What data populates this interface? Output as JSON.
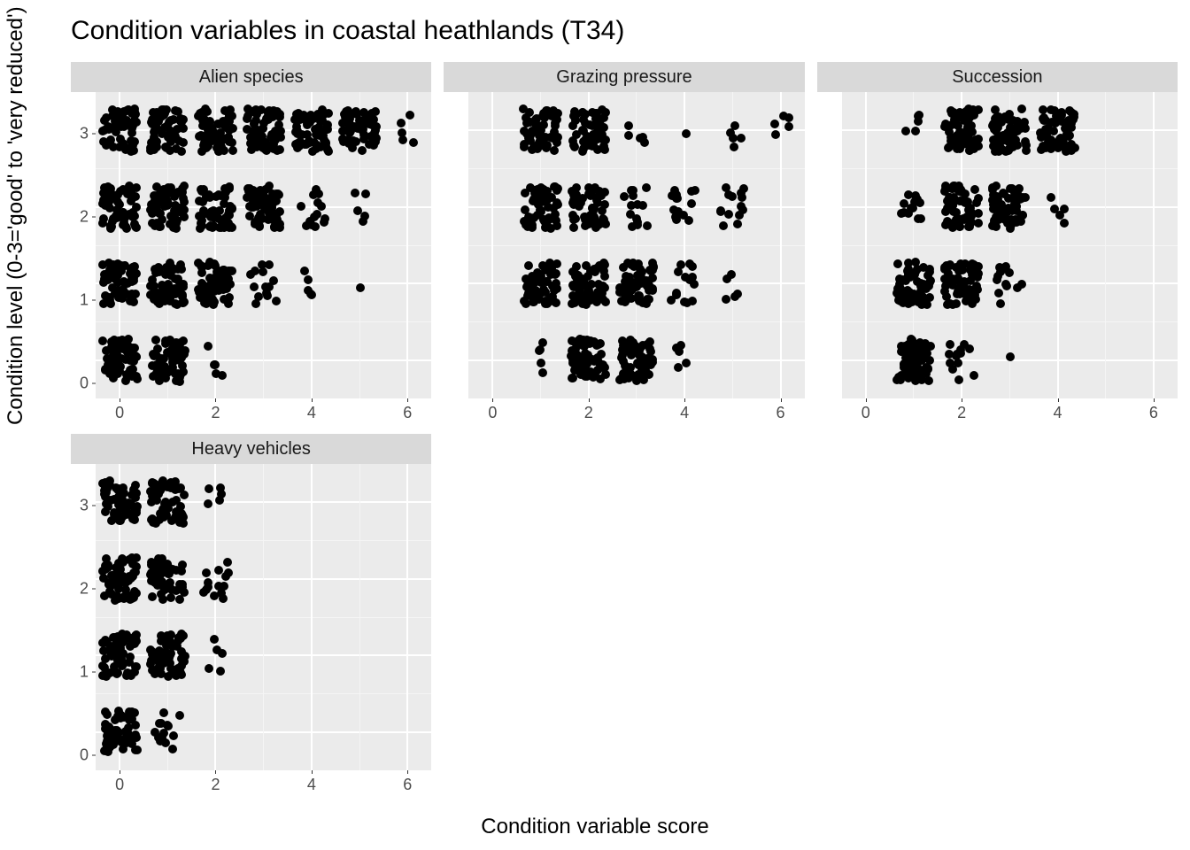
{
  "title": "Condition variables in coastal heathlands (T34)",
  "ylabel": "Condition level (0-3='good' to 'very reduced')",
  "xlabel": "Condition variable score",
  "chart_data": {
    "type": "scatter",
    "xlabel": "Condition variable score",
    "ylabel": "Condition level (0-3='good' to 'very reduced')",
    "title": "Condition variables in coastal heathlands (T34)",
    "xlim": [
      -0.5,
      6.5
    ],
    "ylim": [
      -0.5,
      3.5
    ],
    "xticks": [
      0,
      2,
      4,
      6
    ],
    "yticks": [
      0,
      1,
      2,
      3
    ],
    "panels": [
      {
        "name": "Alien species",
        "cells": [
          {
            "x": 0,
            "y": 0,
            "density": "heavy"
          },
          {
            "x": 1,
            "y": 0,
            "density": "heavy"
          },
          {
            "x": 2,
            "y": 0,
            "density": "few"
          },
          {
            "x": 0,
            "y": 1,
            "density": "heavy"
          },
          {
            "x": 1,
            "y": 1,
            "density": "heavy"
          },
          {
            "x": 2,
            "y": 1,
            "density": "heavy"
          },
          {
            "x": 3,
            "y": 1,
            "density": "scatter"
          },
          {
            "x": 4,
            "y": 1,
            "density": "few"
          },
          {
            "x": 5,
            "y": 1,
            "density": "one"
          },
          {
            "x": 0,
            "y": 2,
            "density": "heavy"
          },
          {
            "x": 1,
            "y": 2,
            "density": "heavy"
          },
          {
            "x": 2,
            "y": 2,
            "density": "heavy"
          },
          {
            "x": 3,
            "y": 2,
            "density": "heavy"
          },
          {
            "x": 4,
            "y": 2,
            "density": "scatter"
          },
          {
            "x": 5,
            "y": 2,
            "density": "few"
          },
          {
            "x": 0,
            "y": 3,
            "density": "heavy"
          },
          {
            "x": 1,
            "y": 3,
            "density": "heavy"
          },
          {
            "x": 2,
            "y": 3,
            "density": "heavy"
          },
          {
            "x": 3,
            "y": 3,
            "density": "heavy"
          },
          {
            "x": 4,
            "y": 3,
            "density": "heavy"
          },
          {
            "x": 5,
            "y": 3,
            "density": "heavy"
          },
          {
            "x": 6,
            "y": 3,
            "density": "few"
          }
        ]
      },
      {
        "name": "Grazing pressure",
        "cells": [
          {
            "x": 1,
            "y": 0,
            "density": "few"
          },
          {
            "x": 2,
            "y": 0,
            "density": "heavy"
          },
          {
            "x": 3,
            "y": 0,
            "density": "heavy"
          },
          {
            "x": 4,
            "y": 0,
            "density": "few"
          },
          {
            "x": 1,
            "y": 1,
            "density": "heavy"
          },
          {
            "x": 2,
            "y": 1,
            "density": "heavy"
          },
          {
            "x": 3,
            "y": 1,
            "density": "heavy"
          },
          {
            "x": 4,
            "y": 1,
            "density": "scatter"
          },
          {
            "x": 5,
            "y": 1,
            "density": "few"
          },
          {
            "x": 1,
            "y": 2,
            "density": "heavy"
          },
          {
            "x": 2,
            "y": 2,
            "density": "heavy"
          },
          {
            "x": 3,
            "y": 2,
            "density": "scatter"
          },
          {
            "x": 4,
            "y": 2,
            "density": "scatter"
          },
          {
            "x": 5,
            "y": 2,
            "density": "scatter"
          },
          {
            "x": 1,
            "y": 3,
            "density": "heavy"
          },
          {
            "x": 2,
            "y": 3,
            "density": "heavy"
          },
          {
            "x": 3,
            "y": 3,
            "density": "few"
          },
          {
            "x": 4,
            "y": 3,
            "density": "one"
          },
          {
            "x": 5,
            "y": 3,
            "density": "few"
          },
          {
            "x": 6,
            "y": 3,
            "density": "few"
          }
        ]
      },
      {
        "name": "Succession",
        "cells": [
          {
            "x": 1,
            "y": 0,
            "density": "heavy"
          },
          {
            "x": 2,
            "y": 0,
            "density": "scatter"
          },
          {
            "x": 3,
            "y": 0,
            "density": "one"
          },
          {
            "x": 1,
            "y": 1,
            "density": "heavy"
          },
          {
            "x": 2,
            "y": 1,
            "density": "heavy"
          },
          {
            "x": 3,
            "y": 1,
            "density": "scatter"
          },
          {
            "x": 1,
            "y": 2,
            "density": "scatter"
          },
          {
            "x": 2,
            "y": 2,
            "density": "heavy"
          },
          {
            "x": 3,
            "y": 2,
            "density": "heavy"
          },
          {
            "x": 4,
            "y": 2,
            "density": "few"
          },
          {
            "x": 1,
            "y": 3,
            "density": "few"
          },
          {
            "x": 2,
            "y": 3,
            "density": "heavy"
          },
          {
            "x": 3,
            "y": 3,
            "density": "heavy"
          },
          {
            "x": 4,
            "y": 3,
            "density": "heavy"
          }
        ]
      },
      {
        "name": "Heavy vehicles",
        "cells": [
          {
            "x": 0,
            "y": 0,
            "density": "heavy"
          },
          {
            "x": 1,
            "y": 0,
            "density": "scatter"
          },
          {
            "x": 0,
            "y": 1,
            "density": "heavy"
          },
          {
            "x": 1,
            "y": 1,
            "density": "heavy"
          },
          {
            "x": 2,
            "y": 1,
            "density": "few"
          },
          {
            "x": 0,
            "y": 2,
            "density": "heavy"
          },
          {
            "x": 1,
            "y": 2,
            "density": "heavy"
          },
          {
            "x": 2,
            "y": 2,
            "density": "scatter"
          },
          {
            "x": 0,
            "y": 3,
            "density": "heavy"
          },
          {
            "x": 1,
            "y": 3,
            "density": "heavy"
          },
          {
            "x": 2,
            "y": 3,
            "density": "few"
          }
        ]
      }
    ]
  }
}
